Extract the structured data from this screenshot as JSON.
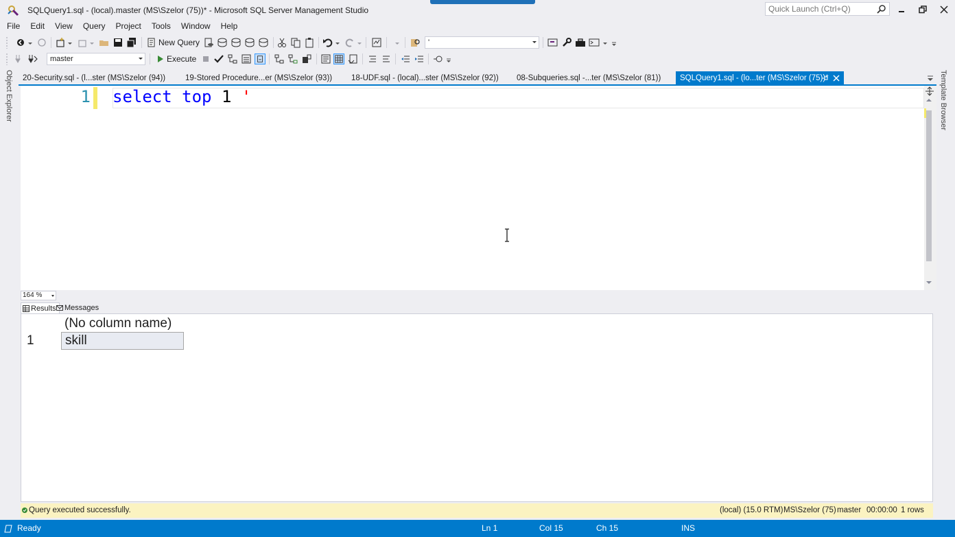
{
  "window": {
    "title": "SQLQuery1.sql - (local).master (MS\\Szelor (75))* - Microsoft SQL Server Management Studio",
    "quick_launch_placeholder": "Quick Launch (Ctrl+Q)"
  },
  "menu": [
    "File",
    "Edit",
    "View",
    "Query",
    "Project",
    "Tools",
    "Window",
    "Help"
  ],
  "toolbar": {
    "new_query_label": "New Query",
    "solution_combo_value": "'",
    "database_combo_value": "master",
    "execute_label": "Execute"
  },
  "side_panels": {
    "left": "Object Explorer",
    "right": "Template Browser"
  },
  "tabs": [
    {
      "label": "20-Security.sql - (l...ster (MS\\Szelor (94))"
    },
    {
      "label": "19-Stored Procedure...er (MS\\Szelor (93))"
    },
    {
      "label": "18-UDF.sql - (local)...ster (MS\\Szelor (92))"
    },
    {
      "label": "08-Subqueries.sql -...ter (MS\\Szelor (81))"
    },
    {
      "label": "SQLQuery1.sql - (lo...ter (MS\\Szelor (75))*",
      "active": true
    }
  ],
  "editor": {
    "line_number": "1",
    "code_keyword1": "select",
    "code_keyword2": "top",
    "code_number": "1",
    "code_string": "'"
  },
  "zoom": "164 %",
  "result_tabs": {
    "results": "Results",
    "messages": "Messages"
  },
  "grid": {
    "column_header": "(No column name)",
    "rows": [
      {
        "num": "1",
        "value": "skill"
      }
    ]
  },
  "info_bar": {
    "message": "Query executed successfully.",
    "server": "(local) (15.0 RTM)",
    "user": "MS\\Szelor (75)",
    "database": "master",
    "elapsed": "00:00:00",
    "rows": "1 rows"
  },
  "status_bar": {
    "state": "Ready",
    "line": "Ln 1",
    "col": "Col 15",
    "ch": "Ch 15",
    "mode": "INS"
  },
  "colors": {
    "accent": "#007acc",
    "info_bar_bg": "#fbf3c1",
    "keyword": "#0000ff",
    "string": "#ff0000",
    "line_number": "#2b91af"
  }
}
